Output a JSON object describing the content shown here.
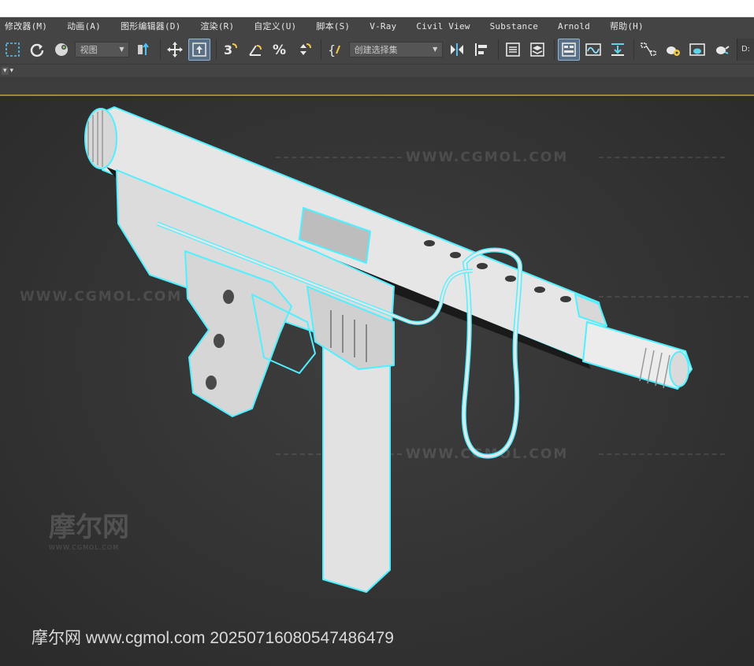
{
  "menu": {
    "items": [
      {
        "label": "修改器(M)"
      },
      {
        "label": "动画(A)"
      },
      {
        "label": "图形编辑器(D)"
      },
      {
        "label": "渲染(R)"
      },
      {
        "label": "自定义(U)"
      },
      {
        "label": "脚本(S)"
      },
      {
        "label": "V-Ray"
      },
      {
        "label": "Civil View"
      },
      {
        "label": "Substance"
      },
      {
        "label": "Arnold"
      },
      {
        "label": "帮助(H)"
      }
    ]
  },
  "toolbar": {
    "view_dropdown": "视图",
    "selection_set_dropdown": "创建选择集",
    "drive_label": "D:"
  },
  "viewport": {
    "watermark_url": "WWW.CGMOL.COM",
    "watermark_logo": "摩尔网",
    "watermark_logo_sub": "WWW.CGMOL.COM"
  },
  "footer": {
    "text": "摩尔网 www.cgmol.com 20250716080547486479"
  },
  "colors": {
    "ui_bg": "#444444",
    "selection_outline": "#4ff0ff",
    "model_fill": "#e2e2e2",
    "active_button": "#5a6e84"
  }
}
